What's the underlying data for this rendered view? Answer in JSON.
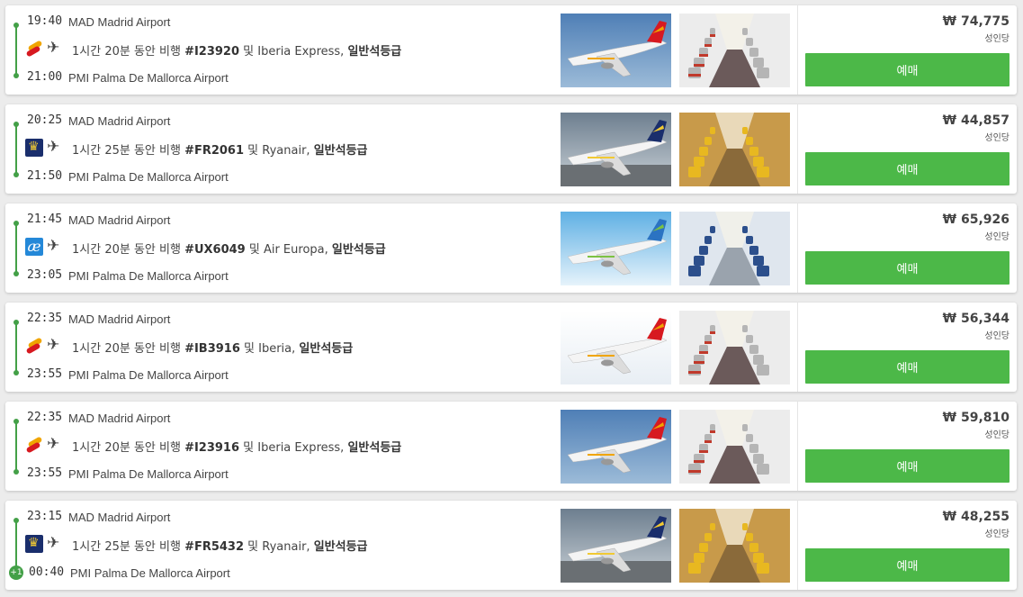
{
  "flights": [
    {
      "dep_time": "19:40",
      "dep_airport": "MAD Madrid Airport",
      "arr_time": "21:00",
      "arr_airport": "PMI Palma De Mallorca Airport",
      "airline_logo": "iberia-logo",
      "duration_text": "1시간 20분 동안 비행 ",
      "flight_no": "#I23920",
      "conj": " 및 ",
      "airline": "Iberia Express",
      "comma": ", ",
      "cabin_class": "일반석등급",
      "next_day": "",
      "plane_livery": "iberia-express",
      "cabin_style": "red",
      "price": "₩ 74,775",
      "per_person": "성인당",
      "book_label": "예매"
    },
    {
      "dep_time": "20:25",
      "dep_airport": "MAD Madrid Airport",
      "arr_time": "21:50",
      "arr_airport": "PMI Palma De Mallorca Airport",
      "airline_logo": "ryanair-logo",
      "duration_text": "1시간 25분 동안 비행 ",
      "flight_no": "#FR2061",
      "conj": " 및 ",
      "airline": "Ryanair",
      "comma": ", ",
      "cabin_class": "일반석등급",
      "next_day": "",
      "plane_livery": "ryanair",
      "cabin_style": "yellow",
      "price": "₩ 44,857",
      "per_person": "성인당",
      "book_label": "예매"
    },
    {
      "dep_time": "21:45",
      "dep_airport": "MAD Madrid Airport",
      "arr_time": "23:05",
      "arr_airport": "PMI Palma De Mallorca Airport",
      "airline_logo": "air-europa-logo",
      "duration_text": "1시간 20분 동안 비행 ",
      "flight_no": "#UX6049",
      "conj": " 및 ",
      "airline": "Air Europa",
      "comma": ", ",
      "cabin_class": "일반석등급",
      "next_day": "",
      "plane_livery": "air-europa",
      "cabin_style": "blue",
      "price": "₩ 65,926",
      "per_person": "성인당",
      "book_label": "예매"
    },
    {
      "dep_time": "22:35",
      "dep_airport": "MAD Madrid Airport",
      "arr_time": "23:55",
      "arr_airport": "PMI Palma De Mallorca Airport",
      "airline_logo": "iberia-logo",
      "duration_text": "1시간 20분 동안 비행 ",
      "flight_no": "#IB3916",
      "conj": " 및 ",
      "airline": "Iberia",
      "comma": ", ",
      "cabin_class": "일반석등급",
      "next_day": "",
      "plane_livery": "iberia",
      "cabin_style": "red",
      "price": "₩ 56,344",
      "per_person": "성인당",
      "book_label": "예매"
    },
    {
      "dep_time": "22:35",
      "dep_airport": "MAD Madrid Airport",
      "arr_time": "23:55",
      "arr_airport": "PMI Palma De Mallorca Airport",
      "airline_logo": "iberia-logo",
      "duration_text": "1시간 20분 동안 비행 ",
      "flight_no": "#I23916",
      "conj": " 및 ",
      "airline": "Iberia Express",
      "comma": ", ",
      "cabin_class": "일반석등급",
      "next_day": "",
      "plane_livery": "iberia-express",
      "cabin_style": "red",
      "price": "₩ 59,810",
      "per_person": "성인당",
      "book_label": "예매"
    },
    {
      "dep_time": "23:15",
      "dep_airport": "MAD Madrid Airport",
      "arr_time": "00:40",
      "arr_airport": "PMI Palma De Mallorca Airport",
      "airline_logo": "ryanair-logo",
      "duration_text": "1시간 25분 동안 비행 ",
      "flight_no": "#FR5432",
      "conj": " 및 ",
      "airline": "Ryanair",
      "comma": ", ",
      "cabin_class": "일반석등급",
      "next_day": "+1",
      "plane_livery": "ryanair",
      "cabin_style": "yellow",
      "price": "₩ 48,255",
      "per_person": "성인당",
      "book_label": "예매"
    }
  ],
  "icons": {
    "plane": "✈"
  },
  "colors": {
    "accent": "#4cb848",
    "timeline": "#43a047"
  }
}
